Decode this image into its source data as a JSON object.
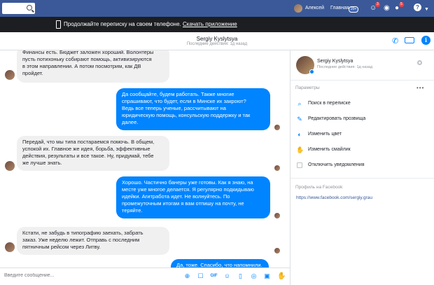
{
  "topbar": {
    "user_name": "Алексей",
    "home_label": "Главная",
    "home_badge": "20+",
    "badges": {
      "friends": "3",
      "notifications": "5"
    },
    "help_icon": "?"
  },
  "banner": {
    "text": "Продолжайте переписку на своем телефоне.",
    "link": "Скачать приложение"
  },
  "conversation": {
    "name": "Sergiy Kyslytsya",
    "status": "Последние действия: 1д назад"
  },
  "messages": [
    {
      "dir": "in",
      "lines": [
        "Финансы есть. Бюджет заложен хороший. Волонтеры",
        "пусть потихоньку собирают помощь, активизируются",
        "в этом направлении. А потом посмотрим, как ДВ",
        "пройдет."
      ]
    },
    {
      "dir": "out",
      "lines": [
        "Да сообщайте, будем работать. Также многие",
        "спрашивают, что будет, если в Минске их закроют?",
        "Ведь все теперь ученые, рассчитывают на",
        "юридическую помощь, консульскую поддержку и так",
        "далее."
      ]
    },
    {
      "dir": "in",
      "lines": [
        "Передай, что мы типа постараемся помочь. В общем,",
        "успокой их. Главное же идея, борьба, эффективные",
        "действия, результаты и все такое. Ну, придумай, тебе",
        "же лучше знать."
      ]
    },
    {
      "dir": "out",
      "lines": [
        "Хорошо. Частично банеры уже готовы. Как я знаю, на",
        "месте уже многое делается. Я регулярно подкидываю",
        "идейки. Агитработа идет. Не волнуйтесь. По",
        "промежуточным итогам я вам отпишу на почту, не",
        "теряйте."
      ]
    },
    {
      "dir": "in",
      "lines": [
        "Кстати, не забудь в типографию заехать, забрать",
        "заказ. Уже неделю лежит.  Отправь с последним",
        "пятничным рейсом через Литву."
      ]
    },
    {
      "dir": "out",
      "lines": [
        "Да, тоже. Спасибо, что напомнили."
      ]
    }
  ],
  "composer": {
    "placeholder": "Введите сообщение..."
  },
  "panel": {
    "name": "Sergiy Kyslytsya",
    "status": "Последние действия: 1д назад",
    "params_title": "Параметры",
    "options": [
      {
        "icon": "search-icon",
        "label": "Поиск в переписке"
      },
      {
        "icon": "pencil-icon",
        "label": "Редактировать прозвища"
      },
      {
        "icon": "palette-icon",
        "label": "Изменить цвет"
      },
      {
        "icon": "thumbs-up-icon",
        "label": "Изменить смайлик"
      },
      {
        "icon": "checkbox-icon",
        "label": "Отключить уведомления"
      }
    ],
    "profile_title": "Профиль на Facebook",
    "profile_link": "https://www.facebook.com/sergiy.grau"
  },
  "colors": {
    "facebook_blue": "#3b5998",
    "messenger_blue": "#0084ff",
    "incoming_bubble": "#f1f0f0",
    "banner_bg": "#1c1e21"
  }
}
